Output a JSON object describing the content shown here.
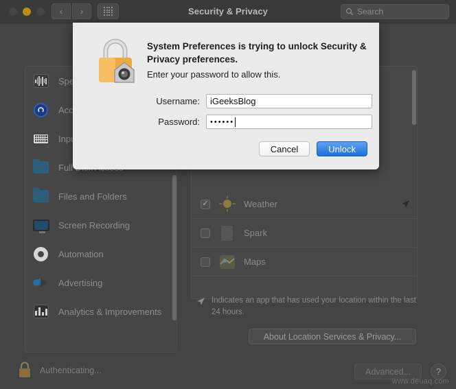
{
  "window": {
    "title": "Security & Privacy",
    "traffic_lights": [
      "close-red",
      "minimize-yellow",
      "zoom-green"
    ],
    "nav": {
      "back": "‹",
      "forward": "›"
    },
    "grid_button": "show-all-grid",
    "search": {
      "placeholder": "Search",
      "icon": "search-icon"
    }
  },
  "sidebar": {
    "items": [
      {
        "label": "Speech Recognition",
        "icon": "waveform-icon"
      },
      {
        "label": "Accessibility",
        "icon": "accessibility-icon"
      },
      {
        "label": "Input Monitoring",
        "icon": "keyboard-icon"
      },
      {
        "label": "Full Disk Access",
        "icon": "folder-icon"
      },
      {
        "label": "Files and Folders",
        "icon": "folder-icon"
      },
      {
        "label": "Screen Recording",
        "icon": "display-icon"
      },
      {
        "label": "Automation",
        "icon": "gear-icon"
      },
      {
        "label": "Advertising",
        "icon": "megaphone-icon"
      },
      {
        "label": "Analytics & Improvements",
        "icon": "bar-chart-icon"
      }
    ]
  },
  "app_list": {
    "rows": [
      {
        "name": "Weather",
        "checked": true,
        "check_glyph": "✓",
        "recent_location": true
      },
      {
        "name": "Spark",
        "checked": false,
        "check_glyph": "",
        "recent_location": false
      },
      {
        "name": "Maps",
        "checked": false,
        "check_glyph": "",
        "recent_location": false
      }
    ]
  },
  "footnote": {
    "icon": "location-arrow-icon",
    "text": "Indicates an app that has used your location within the last 24 hours."
  },
  "about_button": {
    "label": "About Location Services & Privacy..."
  },
  "bottom_bar": {
    "lock_icon": "lock-closed-icon",
    "status": "Authenticating...",
    "advanced_label": "Advanced...",
    "help_label": "?",
    "watermark": "www.deuaq.com"
  },
  "auth_dialog": {
    "icon": "padlock-with-badge-icon",
    "title": "System Preferences is trying to unlock Security & Privacy preferences.",
    "subtitle": "Enter your password to allow this.",
    "username_label": "Username:",
    "username_value": "iGeeksBlog",
    "password_label": "Password:",
    "password_masked": "••••••",
    "cancel_label": "Cancel",
    "unlock_label": "Unlock",
    "accent_color": "#1c72d8"
  }
}
